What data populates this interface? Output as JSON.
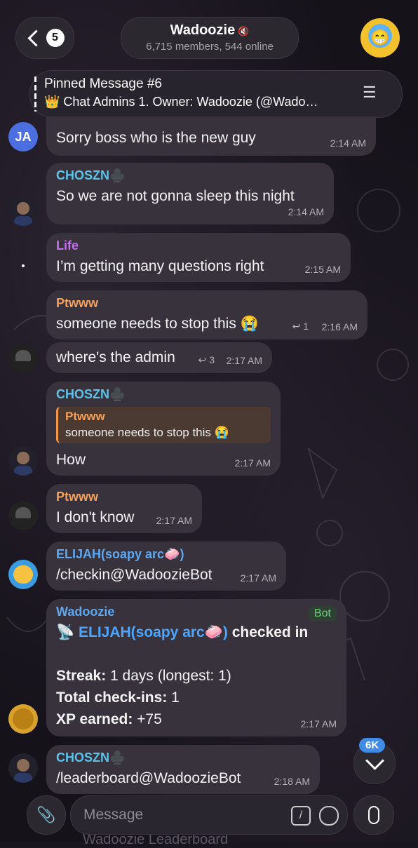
{
  "header": {
    "back_count": "5",
    "title": "Wadoozie",
    "mute_icon": "🔇",
    "subtitle": "6,715 members, 544 online"
  },
  "pinned": {
    "title": "Pinned Message #6",
    "text": "👑 Chat Admins 1. Owner: Wadoozie (@Wado…"
  },
  "messages": {
    "ja": {
      "avatar": "JA",
      "text": "Sorry boss who is the new guy",
      "time": "2:14 AM"
    },
    "choszn1": {
      "sender": "CHOSZN♣️",
      "text": "So we are not gonna sleep this night",
      "time": "2:14 AM"
    },
    "life": {
      "sender": "Life",
      "text": "I’m getting many questions right",
      "time": "2:15 AM"
    },
    "ptwww1": {
      "sender": "Ptwww",
      "text": "someone needs to stop this 😭",
      "replies": "1",
      "time": "2:16 AM"
    },
    "ptwww2": {
      "text": "where's the admin",
      "replies": "3",
      "time": "2:17 AM"
    },
    "choszn2": {
      "sender": "CHOSZN♣️",
      "quote_name": "Ptwww",
      "quote_text": "someone needs to stop this 😭",
      "text": "How",
      "time": "2:17 AM"
    },
    "ptwww3": {
      "sender": "Ptwww",
      "text": "I don't know",
      "time": "2:17 AM"
    },
    "elijah": {
      "sender": "ELIJAH(soapy arc🧼)",
      "text": "/checkin@WadoozieBot",
      "time": "2:17 AM"
    },
    "bot": {
      "sender": "Wadoozie",
      "badge": "Bot",
      "line1_icon": "📡",
      "line1_name": "ELIJAH(soapy arc🧼)",
      "line1_rest": " checked in",
      "streak_label": "Streak:",
      "streak_value": " 1 days (longest: 1)",
      "total_label": "Total check-ins:",
      "total_value": " 1",
      "xp_label": "XP earned:",
      "xp_value": " +75",
      "time": "2:17 AM"
    },
    "choszn3": {
      "sender": "CHOSZN♣️",
      "text": "/leaderboard@WadoozieBot",
      "time": "2:18 AM"
    }
  },
  "unread_badge": "6K",
  "input": {
    "placeholder": "Message",
    "underlay": "Wadoozie Leaderboard"
  }
}
